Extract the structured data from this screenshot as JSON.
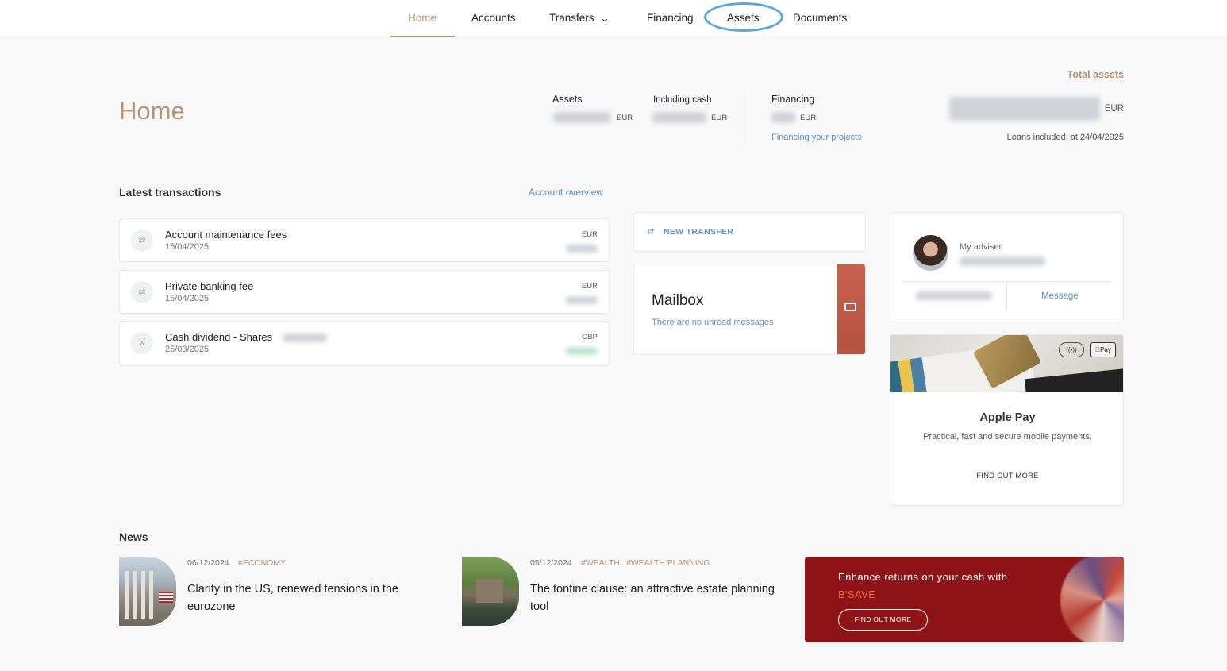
{
  "nav": {
    "items": [
      {
        "label": "Home",
        "active": true
      },
      {
        "label": "Accounts"
      },
      {
        "label": "Transfers"
      },
      {
        "label": "Financing"
      },
      {
        "label": "Assets"
      },
      {
        "label": "Documents"
      }
    ]
  },
  "summary": {
    "title": "Home",
    "assets_label": "Assets",
    "assets_currency": "EUR",
    "cash_label": "Including cash",
    "cash_currency": "EUR",
    "financing_label": "Financing",
    "financing_currency": "EUR",
    "financing_link": "Financing your projects",
    "total_label": "Total assets",
    "total_currency": "EUR",
    "total_note": "Loans included, at 24/04/2025"
  },
  "transactions": {
    "title": "Latest transactions",
    "overview_link": "Account overview",
    "items": [
      {
        "title": "Account maintenance fees",
        "date": "15/04/2025",
        "currency": "EUR",
        "icon": "transfer-icon"
      },
      {
        "title": "Private banking fee",
        "date": "15/04/2025",
        "currency": "EUR",
        "icon": "transfer-icon"
      },
      {
        "title": "Cash dividend - Shares",
        "date": "25/03/2025",
        "currency": "GBP",
        "icon": "bank-icon"
      }
    ]
  },
  "actions": {
    "new_transfer": "NEW TRANSFER"
  },
  "mailbox": {
    "title": "Mailbox",
    "subtitle": "There are no unread messages"
  },
  "adviser": {
    "label": "My adviser",
    "message": "Message"
  },
  "applepay": {
    "title": "Apple Pay",
    "subtitle": "Practical, fast and secure mobile payments.",
    "cta": "FIND OUT MORE",
    "badge": "Pay",
    "nfc": "((•))"
  },
  "news": {
    "title": "News",
    "items": [
      {
        "date": "06/12/2024",
        "tags": [
          "#ECONOMY"
        ],
        "title": "Clarity in the US, renewed tensions in the eurozone"
      },
      {
        "date": "05/12/2024",
        "tags": [
          "#WEALTH",
          "#WEALTH PLANNING"
        ],
        "title": "The tontine clause: an attractive estate planning tool"
      }
    ]
  },
  "banner": {
    "text_main": "Enhance returns on your cash with ",
    "text_highlight": "B'SAVE",
    "cta": "FIND OUT MORE"
  },
  "colors": {
    "accent": "#b39573",
    "link": "#5b8fc7",
    "banner": "#8e1418",
    "highlight_ring": "#5aa6d7"
  }
}
